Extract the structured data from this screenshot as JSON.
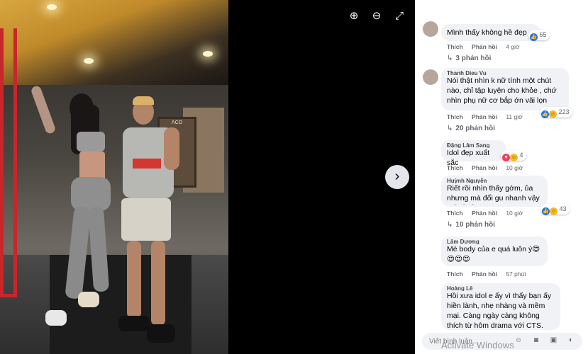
{
  "viewer": {
    "zoom_in_icon": "zoom-in-icon",
    "zoom_out_icon": "zoom-out-icon",
    "fullscreen_icon": "fullscreen-icon",
    "next_icon": "chevron-right-icon",
    "zoom_in_glyph": "⊕",
    "zoom_out_glyph": "⊖",
    "fullscreen_glyph": "⤢",
    "next_glyph": "›",
    "photo_gym_sign": "ΛCO"
  },
  "comments": [
    {
      "author": "",
      "text": "Mình thấy không hề đẹp",
      "reactions": {
        "icons": [
          "like"
        ],
        "count": "65"
      },
      "like_label": "Thích",
      "reply_label": "Phản hồi",
      "time": "4 giờ",
      "replies": "3 phản hồi"
    },
    {
      "author": "Thanh Dieu Vu",
      "text": "Nói thật nhìn k nữ tính một chút nào, chỉ tập luyện cho khỏe , chứ nhìn phụ nữ cơ bắp ớn vãi lọn",
      "reactions": {
        "icons": [
          "like",
          "haha"
        ],
        "count": "223"
      },
      "like_label": "Thích",
      "reply_label": "Phản hồi",
      "time": "11 giờ",
      "replies": "20 phản hồi"
    },
    {
      "author": "Đặng Lâm Sang",
      "text": "Idol đẹp xuất sắc",
      "reactions": {
        "icons": [
          "love",
          "haha"
        ],
        "count": "4"
      },
      "like_label": "Thích",
      "reply_label": "Phản hồi",
      "time": "10 giờ",
      "replies": ""
    },
    {
      "author": "Huỳnh Nguyễn",
      "text": "Riết rồi nhìn thấy gớm, ủa nhưng mà đổi gu nhanh vậy à😂😂😂",
      "reactions": {
        "icons": [
          "like",
          "haha"
        ],
        "count": "43"
      },
      "like_label": "Thích",
      "reply_label": "Phản hồi",
      "time": "10 giờ",
      "replies": "10 phản hồi"
    },
    {
      "author": "Lâm Dương",
      "text": "Mé body của e quá luôn ý😍😍😍😍",
      "reactions": {
        "icons": [],
        "count": ""
      },
      "like_label": "Thích",
      "reply_label": "Phản hồi",
      "time": "57 phút",
      "replies": ""
    },
    {
      "author": "Hoàng Lê",
      "text": "Hồi xưa idol e ấy vì thấy bạn ấy hiền lành, nhẹ nhàng và mềm mại. Càng ngày càng không thích từ hôm drama với CTS. Nay nhìn body em",
      "reactions": {
        "icons": [],
        "count": ""
      },
      "like_label": "",
      "reply_label": "",
      "time": "",
      "replies": ""
    }
  ],
  "composer": {
    "placeholder": "Viết bình luận...",
    "icons": [
      "emoji-icon",
      "camera-icon",
      "gif-icon",
      "sticker-icon"
    ],
    "icons_glyph": "☺ ◙ ▣ ◐"
  },
  "watermark": "Activate Windows"
}
